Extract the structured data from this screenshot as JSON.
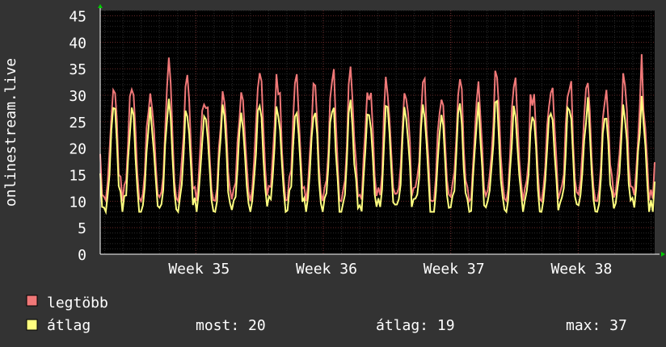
{
  "chart_data": {
    "type": "line",
    "ylabel": "onlinestream.live",
    "ylim": [
      0,
      46
    ],
    "yticks": [
      0,
      5,
      10,
      15,
      20,
      25,
      30,
      35,
      40,
      45
    ],
    "xlim": [
      34.25,
      38.6
    ],
    "xticks": [
      {
        "label": "Week 35",
        "x": 35
      },
      {
        "label": "Week 36",
        "x": 36
      },
      {
        "label": "Week 37",
        "x": 37
      },
      {
        "label": "Week 38",
        "x": 38
      }
    ],
    "grid": true,
    "background": "#000000",
    "series": [
      {
        "name": "legtöbb",
        "color": "#f07878"
      },
      {
        "name": "átlag",
        "color": "#ffff80"
      }
    ]
  },
  "legend": {
    "items": [
      {
        "label": "legtöbb",
        "color": "#f07878"
      },
      {
        "label": "átlag",
        "color": "#ffff80"
      }
    ],
    "stats": {
      "most": "most: 20",
      "atlag": "átlag: 19",
      "max": "max: 37"
    }
  },
  "colors": {
    "canvas": "#333333",
    "plot": "#000000",
    "grid_minor": "#2c2c2c",
    "grid_major": "#6a2a2a",
    "axis_arrow": "#00cc00"
  }
}
